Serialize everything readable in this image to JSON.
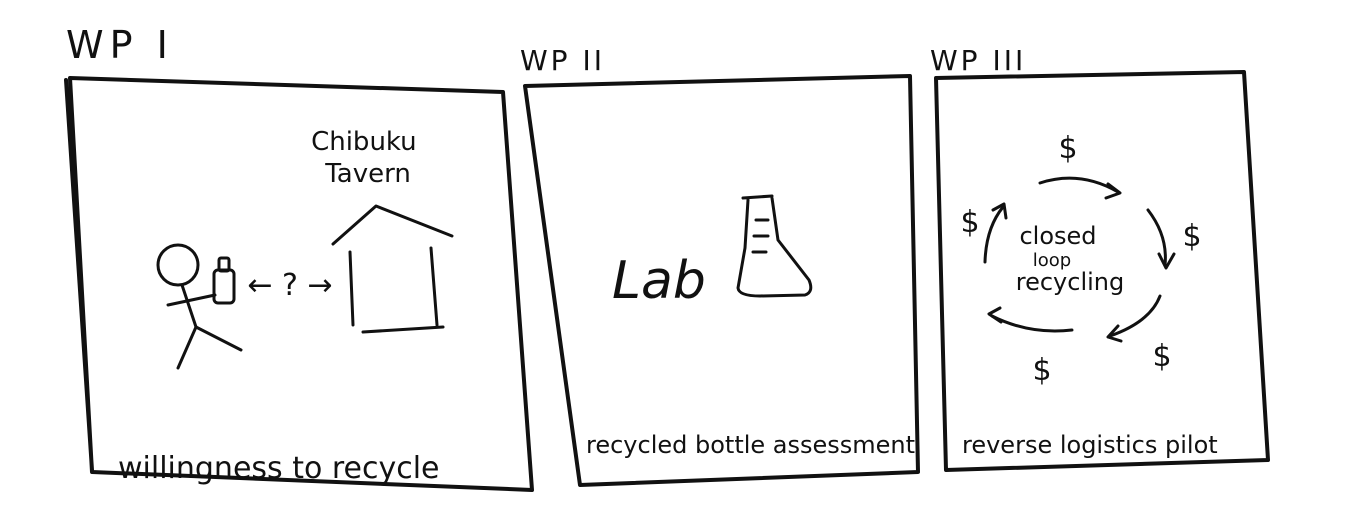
{
  "panels": [
    {
      "label": "WP I",
      "caption": "willingness to recycle",
      "sign": "Chibuku Tavern",
      "question": "← ? →"
    },
    {
      "label": "WP II",
      "caption": "recycled bottle assessment",
      "word": "Lab"
    },
    {
      "label": "WP III",
      "caption": "reverse logistics pilot",
      "center": [
        "closed",
        "loop",
        "recycling"
      ],
      "currency": "$"
    }
  ]
}
